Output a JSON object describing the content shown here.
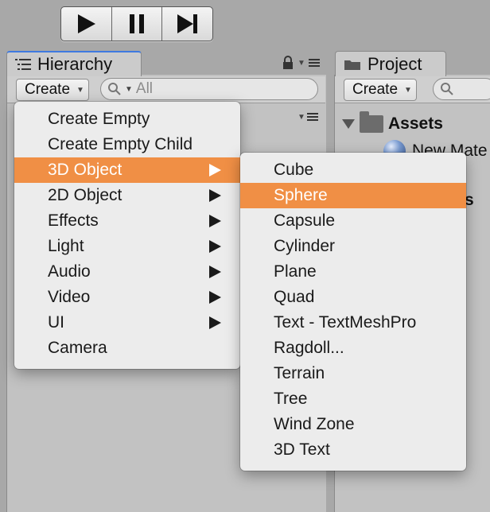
{
  "playbar": {
    "buttons": [
      {
        "icon": "play-icon"
      },
      {
        "icon": "pause-icon"
      },
      {
        "icon": "step-icon"
      }
    ]
  },
  "hierarchy": {
    "tab_label": "Hierarchy",
    "create_label": "Create",
    "search_placeholder": "All"
  },
  "project": {
    "tab_label": "Project",
    "create_label": "Create",
    "assets_label": "Assets",
    "material_label": "New Mate",
    "partial_text": "s"
  },
  "create_menu": {
    "items": [
      {
        "label": "Create Empty",
        "submenu": false
      },
      {
        "label": "Create Empty Child",
        "submenu": false
      },
      {
        "label": "3D Object",
        "submenu": true,
        "active": true
      },
      {
        "label": "2D Object",
        "submenu": true
      },
      {
        "label": "Effects",
        "submenu": true
      },
      {
        "label": "Light",
        "submenu": true
      },
      {
        "label": "Audio",
        "submenu": true
      },
      {
        "label": "Video",
        "submenu": true
      },
      {
        "label": "UI",
        "submenu": true
      },
      {
        "label": "Camera",
        "submenu": false
      }
    ]
  },
  "object_submenu": {
    "items": [
      {
        "label": "Cube"
      },
      {
        "label": "Sphere",
        "active": true
      },
      {
        "label": "Capsule"
      },
      {
        "label": "Cylinder"
      },
      {
        "label": "Plane"
      },
      {
        "label": "Quad"
      },
      {
        "label": "Text - TextMeshPro"
      },
      {
        "label": "Ragdoll..."
      },
      {
        "label": "Terrain"
      },
      {
        "label": "Tree"
      },
      {
        "label": "Wind Zone"
      },
      {
        "label": "3D Text"
      }
    ]
  },
  "colors": {
    "highlight": "#f08f45",
    "tab_accent": "#3f7ae0"
  }
}
